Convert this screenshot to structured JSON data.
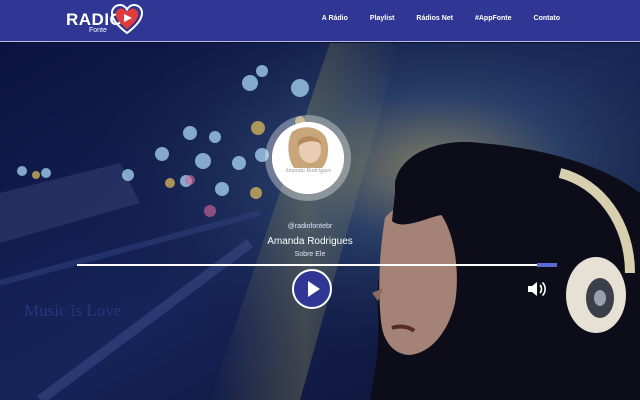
{
  "brand": {
    "name": "RADIO",
    "sub": "Fonte",
    "logo_icon": "heart-play-logo-icon",
    "colors": {
      "header": "#2f3694",
      "accent": "#e23b3b",
      "play": "#2f3694"
    }
  },
  "nav": {
    "items": [
      {
        "label": "A Rádio"
      },
      {
        "label": "Playlist"
      },
      {
        "label": "Rádios Net"
      },
      {
        "label": "#AppFonte"
      },
      {
        "label": "Contato"
      }
    ]
  },
  "hero": {
    "tagline": "Music is Love"
  },
  "player": {
    "cover_signature": "Amanda Rodrigues",
    "handle": "@radiofontebr",
    "artist": "Amanda Rodrigues",
    "song": "Sobre Ele",
    "play_icon": "play-icon",
    "volume_icon": "volume-icon"
  }
}
